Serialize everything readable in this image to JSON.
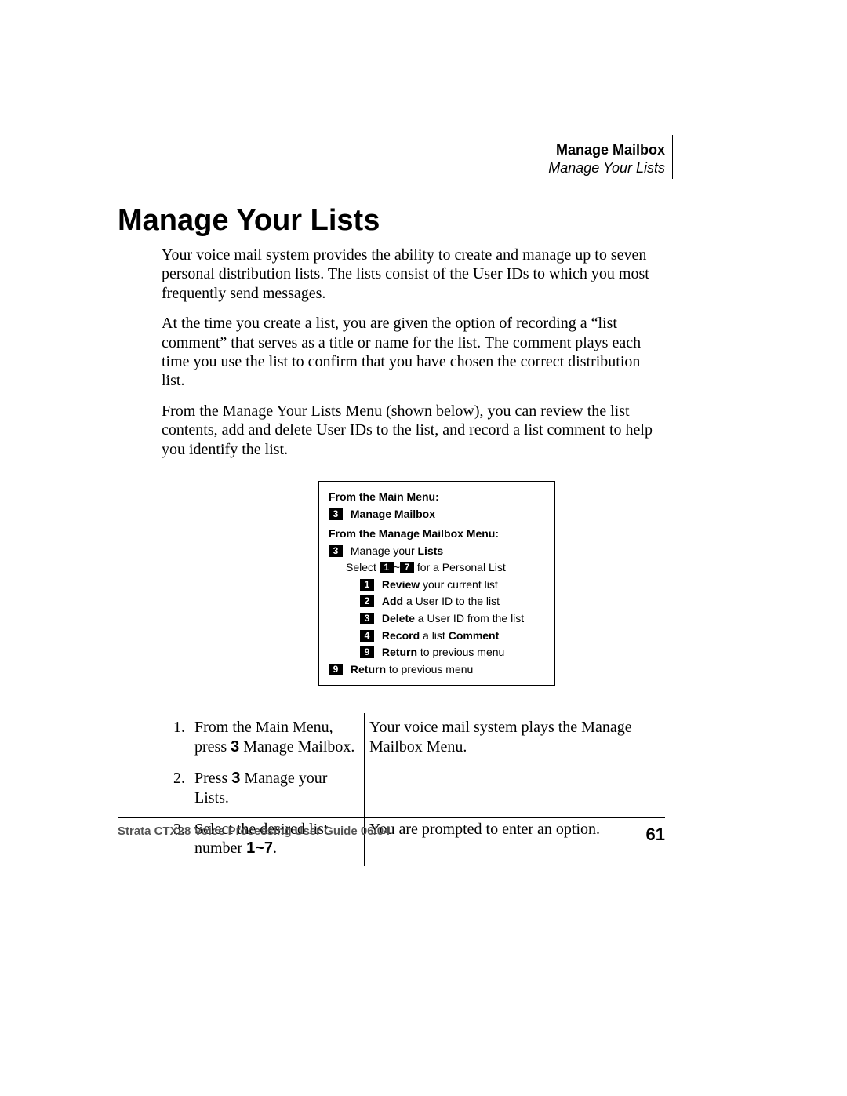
{
  "header": {
    "chapter": "Manage Mailbox",
    "section": "Manage Your Lists"
  },
  "title": "Manage Your Lists",
  "paragraphs": {
    "p1": "Your voice mail system provides the ability to create and manage up to seven personal distribution lists. The lists consist of the User IDs to which you most frequently send messages.",
    "p2": "At the time you create a list, you are given the option of recording a “list comment” that serves as a title or name for the list. The comment plays each time you use the list to confirm that you have chosen the correct distribution list.",
    "p3": "From the Manage Your Lists Menu (shown below), you can review the list contents, add and delete User IDs to the list, and record a list comment to help you identify the list."
  },
  "menu": {
    "head1": "From the Main Menu:",
    "key_manage": "3",
    "label_manage": "Manage Mailbox",
    "head2": "From the Manage Mailbox Menu:",
    "key_lists": "3",
    "label_lists_pre": "Manage your ",
    "label_lists_bold": "Lists",
    "select_pre": "Select ",
    "select_lo": "1",
    "select_sep": "~",
    "select_hi": "7",
    "select_post": " for a Personal List",
    "opt1_key": "1",
    "opt1_bold": "Review",
    "opt1_rest": " your current list",
    "opt2_key": "2",
    "opt2_bold": "Add",
    "opt2_rest": " a User ID to the list",
    "opt3_key": "3",
    "opt3_bold": "Delete",
    "opt3_rest": " a User ID from the list",
    "opt4_key": "4",
    "opt4_bold1": "Record",
    "opt4_mid": " a list ",
    "opt4_bold2": "Comment",
    "opt5_key": "9",
    "opt5_bold": "Return",
    "opt5_rest": " to previous menu",
    "ret_key": "9",
    "ret_bold": "Return",
    "ret_rest": " to previous menu"
  },
  "steps": {
    "s1_idx": "1.",
    "s1_left_a": "From the Main Menu, press ",
    "s1_left_key": "3",
    "s1_left_b": " Manage Mailbox.",
    "s1_right": "Your voice mail system plays the Manage Mailbox Menu.",
    "s2_idx": "2.",
    "s2_left_a": "Press ",
    "s2_left_key": "3",
    "s2_left_b": " Manage your Lists.",
    "s2_right": "",
    "s3_idx": "3.",
    "s3_left_a": "Select the desired list number ",
    "s3_left_key": "1~7",
    "s3_left_b": ".",
    "s3_right": "You are prompted to enter an option."
  },
  "footer": {
    "title": "Strata CTX28 Voice Processing User Guide   06/04",
    "page": "61"
  }
}
